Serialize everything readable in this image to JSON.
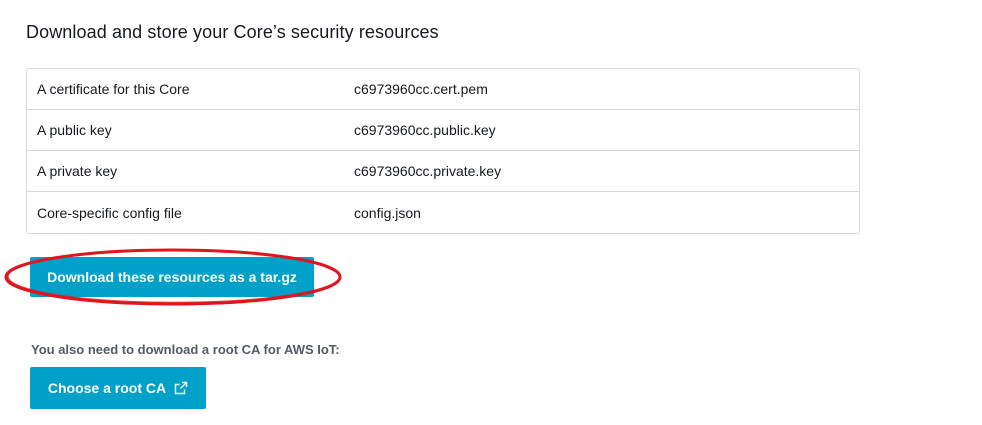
{
  "section": {
    "title": "Download and store your Core’s security resources"
  },
  "resources": [
    {
      "label": "A certificate for this Core",
      "file": "c6973960cc.cert.pem"
    },
    {
      "label": "A public key",
      "file": "c6973960cc.public.key"
    },
    {
      "label": "A private key",
      "file": "c6973960cc.private.key"
    },
    {
      "label": "Core-specific config file",
      "file": "config.json"
    }
  ],
  "download": {
    "label": "Download these resources as a tar.gz"
  },
  "root_ca": {
    "note": "You also need to download a root CA for AWS IoT:",
    "button_label": "Choose a root CA",
    "icon": "external-link-icon"
  },
  "colors": {
    "primary": "#00a1c9",
    "highlight": "#e0151e",
    "border": "#d5dbdb"
  }
}
